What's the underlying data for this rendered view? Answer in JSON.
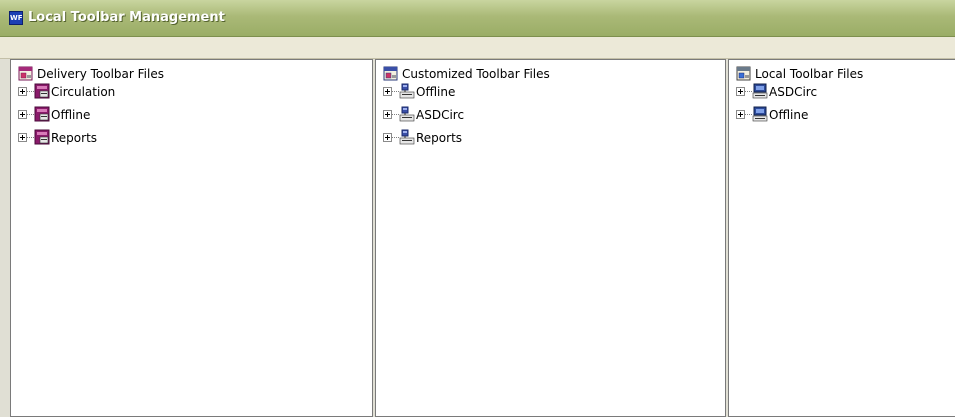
{
  "window": {
    "title": "Local Toolbar Management",
    "app_icon": "wf-app-icon",
    "app_icon_text": "WF"
  },
  "panels": [
    {
      "root": {
        "label": "Delivery Toolbar Files",
        "icon": "toolbar-root-icon"
      },
      "items": [
        {
          "label": "Circulation",
          "icon": "delivery-toolbar-icon"
        },
        {
          "label": "Offline",
          "icon": "delivery-toolbar-icon"
        },
        {
          "label": "Reports",
          "icon": "delivery-toolbar-icon"
        }
      ]
    },
    {
      "root": {
        "label": "Customized Toolbar Files",
        "icon": "toolbar-root-icon"
      },
      "items": [
        {
          "label": "Offline",
          "icon": "customized-toolbar-icon"
        },
        {
          "label": "ASDCirc",
          "icon": "customized-toolbar-icon"
        },
        {
          "label": "Reports",
          "icon": "customized-toolbar-icon"
        }
      ]
    },
    {
      "root": {
        "label": "Local Toolbar Files",
        "icon": "toolbar-root-icon"
      },
      "items": [
        {
          "label": "ASDCirc",
          "icon": "local-toolbar-icon"
        },
        {
          "label": "Offline",
          "icon": "local-toolbar-icon"
        }
      ]
    }
  ],
  "colors": {
    "titlebar": "#9aad66",
    "delivery_icon": "#8b1a6b",
    "customized_icon": "#3a4fa8",
    "local_icon": "#2c4a9a"
  }
}
